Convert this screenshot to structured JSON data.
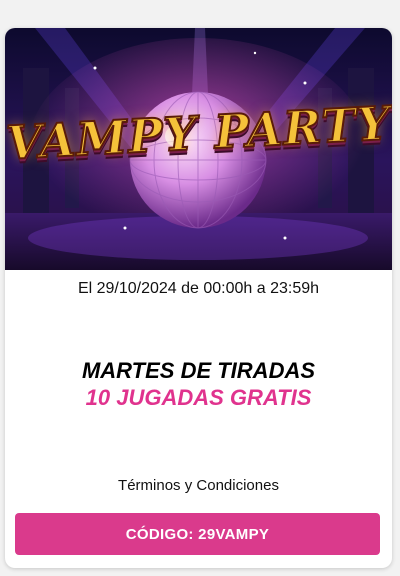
{
  "banner": {
    "game_title": "VAMPY PARTY"
  },
  "promo": {
    "date_text": "El 29/10/2024 de 00:00h a 23:59h",
    "headline": "MARTES DE TIRADAS",
    "subheadline": "10 JUGADAS GRATIS",
    "terms_link": "Términos y Condiciones",
    "code_button": "CÓDIGO: 29VAMPY"
  },
  "colors": {
    "accent": "#da3a8c",
    "subheadline": "#e0338e",
    "logo_gold": "#f5c23a"
  },
  "icons": {
    "banner_art": "disco-ball-illustration"
  }
}
